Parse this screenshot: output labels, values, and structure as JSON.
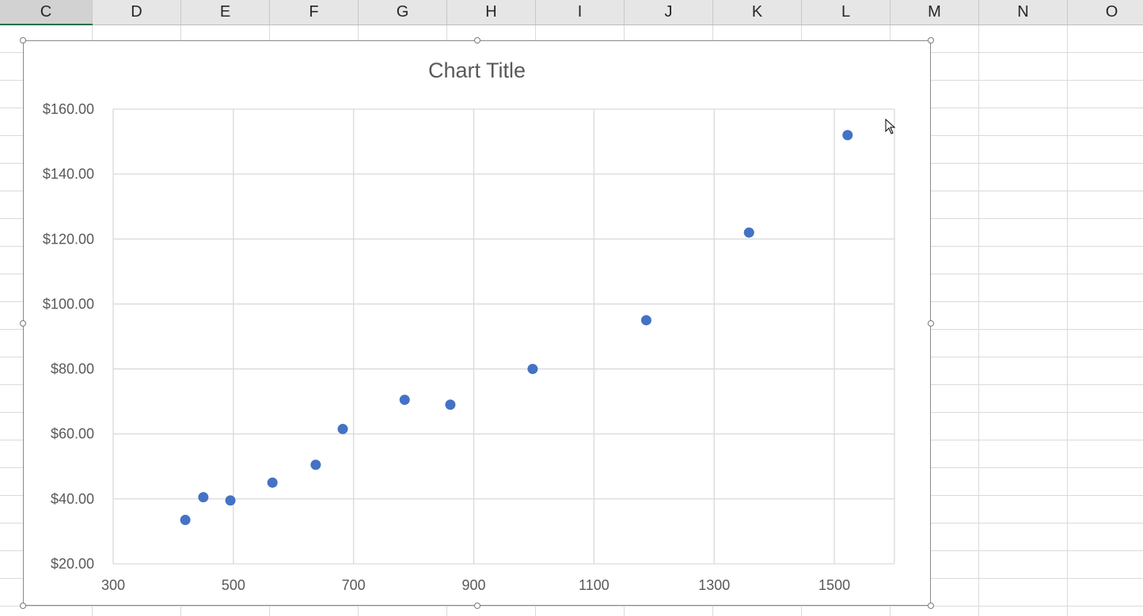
{
  "spreadsheet": {
    "columns": [
      "C",
      "D",
      "E",
      "F",
      "G",
      "H",
      "I",
      "J",
      "K",
      "L",
      "M",
      "N",
      "O"
    ],
    "selected_column": "C"
  },
  "chart": {
    "title": "Chart Title"
  },
  "colors": {
    "marker": "#4472c4",
    "gridline": "#d9d9d9",
    "header_bg": "#e6e6e6",
    "selection_accent": "#217346"
  },
  "chart_data": {
    "type": "scatter",
    "title": "Chart Title",
    "xlabel": "",
    "ylabel": "",
    "xlim": [
      300,
      1600
    ],
    "ylim": [
      20,
      160
    ],
    "x_ticks": [
      300,
      500,
      700,
      900,
      1100,
      1300,
      1500
    ],
    "x_tick_labels": [
      "300",
      "500",
      "700",
      "900",
      "1100",
      "1300",
      "1500"
    ],
    "y_ticks": [
      20,
      40,
      60,
      80,
      100,
      120,
      140,
      160
    ],
    "y_tick_labels": [
      "$20.00",
      "$40.00",
      "$60.00",
      "$80.00",
      "$100.00",
      "$120.00",
      "$140.00",
      "$160.00"
    ],
    "grid": true,
    "legend": "none",
    "series": [
      {
        "x": [
          420,
          450,
          495,
          565,
          637,
          682,
          785,
          861,
          998,
          1187,
          1358,
          1522
        ],
        "y": [
          33.5,
          40.5,
          39.5,
          45.0,
          50.5,
          61.5,
          70.5,
          69.0,
          80.0,
          95.0,
          122.0,
          152.0
        ]
      }
    ]
  }
}
